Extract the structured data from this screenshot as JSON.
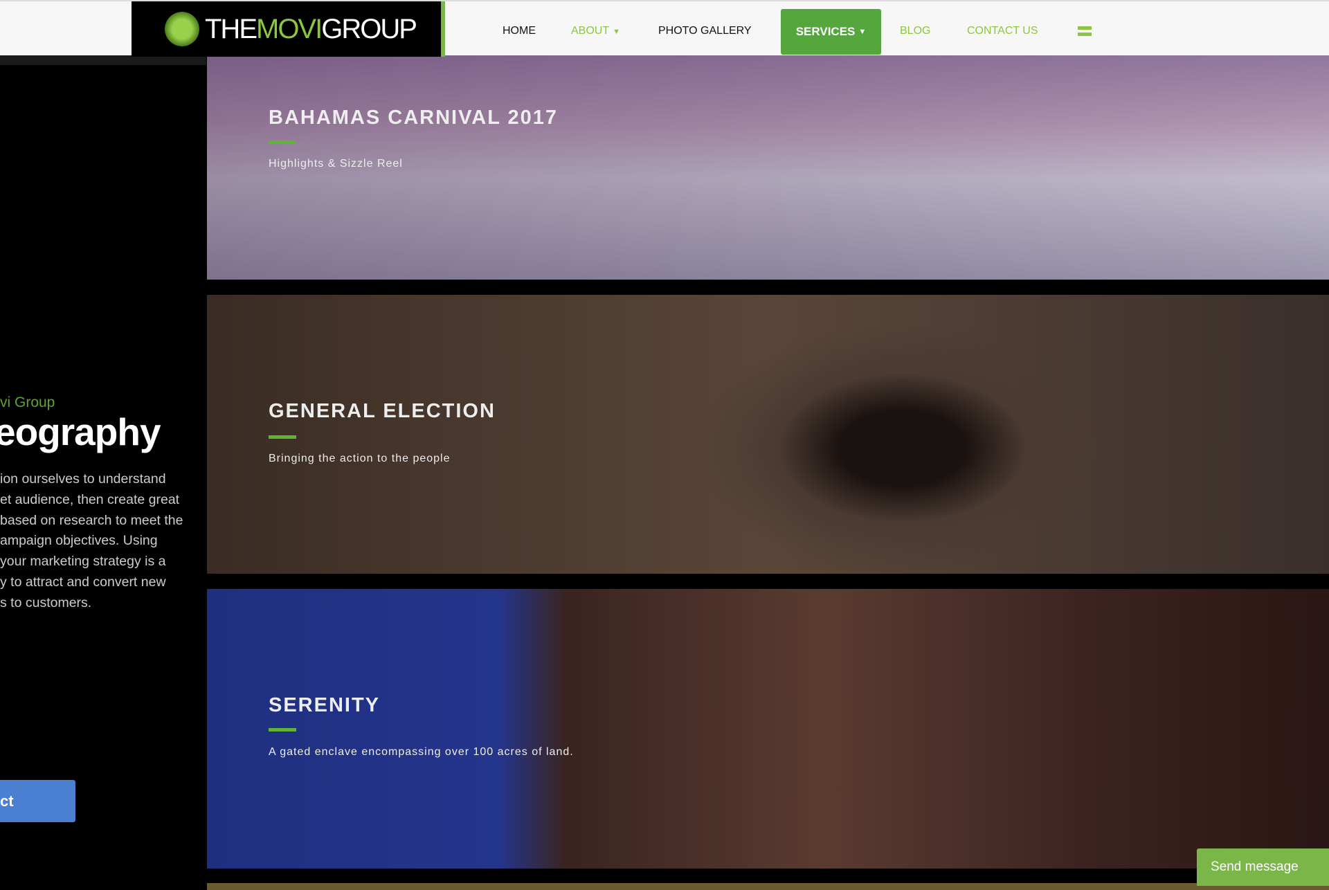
{
  "header": {
    "logo_text": {
      "the": "THE",
      "movi": "MOVI",
      "group": "GROUP"
    },
    "nav": {
      "home": "HOME",
      "about": "ABOUT",
      "photo_gallery": "PHOTO GALLERY",
      "services": "SERVICES",
      "blog": "BLOG",
      "contact": "CONTACT US"
    },
    "accent": "#8cc63f",
    "services_bg": "#55a63c"
  },
  "intro": {
    "eyebrow": "vi Group",
    "heading": "eography",
    "paragraph": "ion ourselves to understand\net audience, then create great\nbased on research to meet the\nampaign objectives. Using\nyour marketing strategy is a\ny to attract and convert new\ns to customers.",
    "cta": "ct"
  },
  "cards": [
    {
      "title": "BAHAMAS CARNIVAL 2017",
      "subtitle": "Highlights & Sizzle Reel"
    },
    {
      "title": "GENERAL ELECTION",
      "subtitle": "Bringing the action to the people"
    },
    {
      "title": "SERENITY",
      "subtitle": "A gated enclave encompassing over 100 acres of land."
    }
  ],
  "chat": {
    "send": "Send message"
  }
}
